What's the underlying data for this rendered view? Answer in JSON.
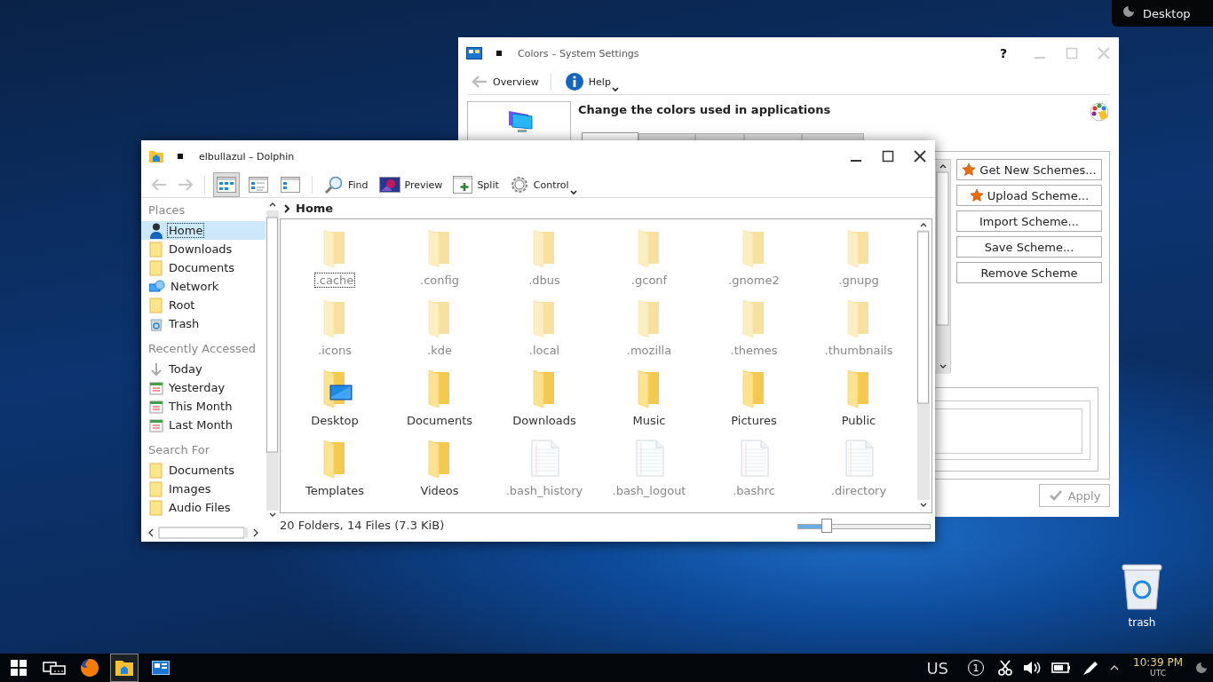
{
  "desktop": {
    "panel_label": "Desktop",
    "icons": [
      {
        "label": "trash"
      }
    ]
  },
  "settings_window": {
    "title": "Colors – System Settings",
    "help_glyph": "?",
    "toolbar": [
      {
        "kind": "back",
        "label": "Overview",
        "menu": false
      },
      {
        "kind": "info",
        "label": "Help",
        "menu": true
      }
    ],
    "heading": "Change the colors used in applications",
    "tabs": [
      {
        "selected": true
      },
      {
        "selected": false
      },
      {
        "selected": false
      },
      {
        "selected": false
      },
      {
        "selected": false
      }
    ],
    "buttons": [
      {
        "label": "Get New Schemes...",
        "kind": "star"
      },
      {
        "label": "Upload Scheme...",
        "kind": "star"
      },
      {
        "label": "Import Scheme...",
        "kind": "plain"
      },
      {
        "label": "Save Scheme...",
        "kind": "plain"
      },
      {
        "label": "Remove Scheme",
        "kind": "plain"
      }
    ],
    "apply": {
      "label": "Apply",
      "disabled": true
    }
  },
  "dolphin": {
    "title": "elbullazul – Dolphin",
    "nav": [
      {
        "kind": "back",
        "disabled": true
      },
      {
        "kind": "forward",
        "disabled": true
      }
    ],
    "view_modes": [
      {
        "kind": "icons",
        "selected": true
      },
      {
        "kind": "compact",
        "selected": false
      },
      {
        "kind": "details",
        "selected": false
      }
    ],
    "actions": [
      {
        "kind": "find",
        "label": "Find",
        "menu": false
      },
      {
        "kind": "preview",
        "label": "Preview",
        "menu": false
      },
      {
        "kind": "split",
        "label": "Split",
        "menu": false
      },
      {
        "kind": "gear",
        "label": "Control",
        "menu": true
      }
    ],
    "sidebar": [
      {
        "title": "Places",
        "items": [
          {
            "label": "Home",
            "kind": "user",
            "selected": true
          },
          {
            "label": "Downloads",
            "kind": "folder",
            "selected": false
          },
          {
            "label": "Documents",
            "kind": "folder",
            "selected": false
          },
          {
            "label": "Network",
            "kind": "network",
            "selected": false
          },
          {
            "label": "Root",
            "kind": "folder",
            "selected": false
          },
          {
            "label": "Trash",
            "kind": "trash",
            "selected": false
          }
        ]
      },
      {
        "title": "Recently Accessed",
        "items": [
          {
            "label": "Today",
            "kind": "recent",
            "selected": false
          },
          {
            "label": "Yesterday",
            "kind": "calendar",
            "selected": false
          },
          {
            "label": "This Month",
            "kind": "calendar",
            "selected": false
          },
          {
            "label": "Last Month",
            "kind": "calendar",
            "selected": false
          }
        ]
      },
      {
        "title": "Search For",
        "items": [
          {
            "label": "Documents",
            "kind": "folder",
            "selected": false
          },
          {
            "label": "Images",
            "kind": "folder",
            "selected": false
          },
          {
            "label": "Audio Files",
            "kind": "folder",
            "selected": false
          }
        ]
      }
    ],
    "breadcrumb": "Home",
    "files": [
      {
        "name": ".cache",
        "kind": "folder",
        "hidden": true,
        "focused": true
      },
      {
        "name": ".config",
        "kind": "folder",
        "hidden": true,
        "focused": false
      },
      {
        "name": ".dbus",
        "kind": "folder",
        "hidden": true,
        "focused": false
      },
      {
        "name": ".gconf",
        "kind": "folder",
        "hidden": true,
        "focused": false
      },
      {
        "name": ".gnome2",
        "kind": "folder",
        "hidden": true,
        "focused": false
      },
      {
        "name": ".gnupg",
        "kind": "folder",
        "hidden": true,
        "focused": false
      },
      {
        "name": ".icons",
        "kind": "folder",
        "hidden": true,
        "focused": false
      },
      {
        "name": ".kde",
        "kind": "folder",
        "hidden": true,
        "focused": false
      },
      {
        "name": ".local",
        "kind": "folder",
        "hidden": true,
        "focused": false
      },
      {
        "name": ".mozilla",
        "kind": "folder",
        "hidden": true,
        "focused": false
      },
      {
        "name": ".themes",
        "kind": "folder",
        "hidden": true,
        "focused": false
      },
      {
        "name": ".thumbnails",
        "kind": "folder",
        "hidden": true,
        "focused": false
      },
      {
        "name": "Desktop",
        "kind": "desktop-folder",
        "hidden": false,
        "focused": false
      },
      {
        "name": "Documents",
        "kind": "folder",
        "hidden": false,
        "focused": false
      },
      {
        "name": "Downloads",
        "kind": "folder",
        "hidden": false,
        "focused": false
      },
      {
        "name": "Music",
        "kind": "folder",
        "hidden": false,
        "focused": false
      },
      {
        "name": "Pictures",
        "kind": "folder",
        "hidden": false,
        "focused": false
      },
      {
        "name": "Public",
        "kind": "folder",
        "hidden": false,
        "focused": false
      },
      {
        "name": "Templates",
        "kind": "folder",
        "hidden": false,
        "focused": false
      },
      {
        "name": "Videos",
        "kind": "folder",
        "hidden": false,
        "focused": false
      },
      {
        "name": ".bash_history",
        "kind": "file",
        "hidden": true,
        "focused": false
      },
      {
        "name": ".bash_logout",
        "kind": "file",
        "hidden": true,
        "focused": false
      },
      {
        "name": ".bashrc",
        "kind": "file",
        "hidden": true,
        "focused": false
      },
      {
        "name": ".directory",
        "kind": "file",
        "hidden": true,
        "focused": false
      }
    ],
    "status": "20 Folders, 14 Files (7.3 KiB)",
    "zoom": {
      "level": 0.22
    }
  },
  "taskbar": {
    "apps": [
      {
        "kind": "start",
        "selected": false
      },
      {
        "kind": "tasks",
        "selected": false
      },
      {
        "kind": "firefox",
        "selected": false
      },
      {
        "kind": "files",
        "selected": true
      },
      {
        "kind": "settings",
        "selected": false
      }
    ],
    "keyboard": "US",
    "notifications": "1",
    "tray": [
      {
        "kind": "scissors"
      },
      {
        "kind": "speaker"
      },
      {
        "kind": "battery"
      },
      {
        "kind": "pen"
      },
      {
        "kind": "caret"
      }
    ],
    "time": "10:39 PM",
    "timezone": "UTC"
  }
}
